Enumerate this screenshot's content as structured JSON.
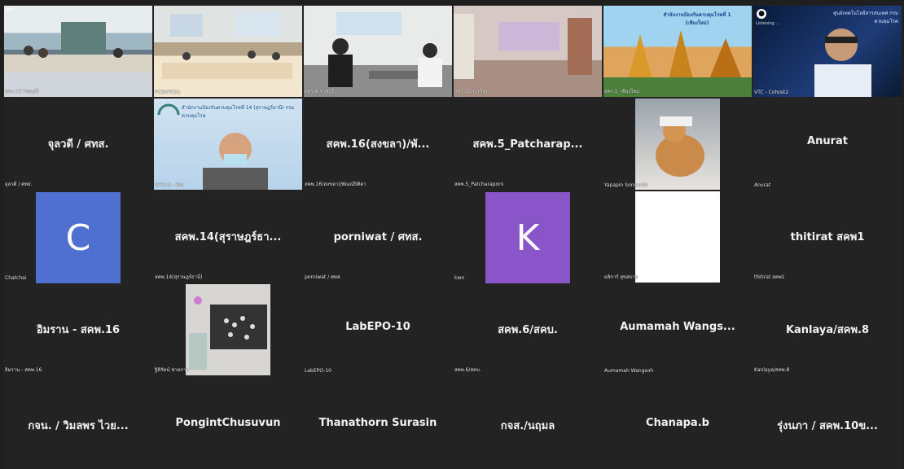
{
  "colors": {
    "bg": "#1f1f1f",
    "tile": "#232323",
    "avatar_c": "#4f6fd1",
    "avatar_k": "#8a55c8"
  },
  "icons": {
    "back": "arrow-left-icon",
    "headset": "headset-icon"
  },
  "tiles": [
    {
      "id": "t1",
      "caption": "สคร.13 (ชลบุรี)",
      "type": "video"
    },
    {
      "id": "t2",
      "caption": "PCDVTC01",
      "type": "video"
    },
    {
      "id": "t3",
      "caption": "สคร.8 ราชบุรี",
      "type": "video"
    },
    {
      "id": "t4",
      "caption": "สคร.15 (ภูเก็ต)",
      "type": "video"
    },
    {
      "id": "t5",
      "caption": "สคร.1_เชียงใหม่",
      "type": "video",
      "banner": "สำนักงานป้องกันควบคุมโรคที่ 1 (เชียงใหม่)"
    },
    {
      "id": "t6",
      "caption": "VTC - Cohost2",
      "type": "video",
      "status": "Listening ...",
      "banner": "ศูนย์เทคโนโลยีสารสนเทศ กรมควบคุมโรค"
    },
    {
      "id": "t7",
      "name": "จุลวดี / ศทส.",
      "caption": "จุลวดี / ศทส."
    },
    {
      "id": "t8",
      "caption": "EPO14 - KW",
      "type": "video",
      "banner": "สำนักงานป้องกันควบคุมโรคที่ 14 (สุราษฎร์ธานี) กรมควบคุมโรค"
    },
    {
      "id": "t9",
      "name": "สคพ.16(สงขลา)/พั...",
      "caption": "สคพ.16(สงขลา)/พัณณ์ปิติดา"
    },
    {
      "id": "t10",
      "name": "สคพ.5_Patcharap...",
      "caption": "สคพ.5_Patcharaporn"
    },
    {
      "id": "t11",
      "caption": "Yapapin Sonsutthi",
      "type": "video"
    },
    {
      "id": "t12",
      "name": "Anurat",
      "caption": "Anurat"
    },
    {
      "id": "t13",
      "caption": "Chatchai",
      "avatar": "C"
    },
    {
      "id": "t14",
      "name": "สคพ.14(สุราษฎร์ธา...",
      "caption": "สคพ.14(สุราษฎร์ธานี)"
    },
    {
      "id": "t15",
      "name": "porniwat / ศทส.",
      "caption": "porniwat / ศทส."
    },
    {
      "id": "t16",
      "caption": "kwn",
      "avatar": "K"
    },
    {
      "id": "t17",
      "caption": "ผลิการ์ สุขสบาย",
      "type": "blank"
    },
    {
      "id": "t18",
      "name": "thitirat สคพ1",
      "caption": "thitirat สคพ1"
    },
    {
      "id": "t19",
      "name": "อิมราน - สคพ.16",
      "caption": "อิมราน - สคพ.16"
    },
    {
      "id": "t20",
      "caption": "ฐิติรัตน์ ชายการ",
      "type": "video"
    },
    {
      "id": "t21",
      "name": "LabEPO-10",
      "caption": "LabEPO-10"
    },
    {
      "id": "t22",
      "name": "สคพ.6/สคบ.",
      "caption": "สคพ.6/สคบ."
    },
    {
      "id": "t23",
      "name": "Aumamah  Wangs...",
      "caption": "Aumamah Wangsoh"
    },
    {
      "id": "t24",
      "name": "Kanlaya/สคพ.8",
      "caption": "Kanlaya/สคพ.8"
    },
    {
      "id": "t25",
      "name": "กจน. / วิมลพร ไวย..."
    },
    {
      "id": "t26",
      "name": "PongintChusuvun"
    },
    {
      "id": "t27",
      "name": "Thanathorn Surasin"
    },
    {
      "id": "t28",
      "name": "กจส./นฤมล"
    },
    {
      "id": "t29",
      "name": "Chanapa.b"
    },
    {
      "id": "t30",
      "name": "รุ่งนภา / สคพ.10ข..."
    }
  ]
}
